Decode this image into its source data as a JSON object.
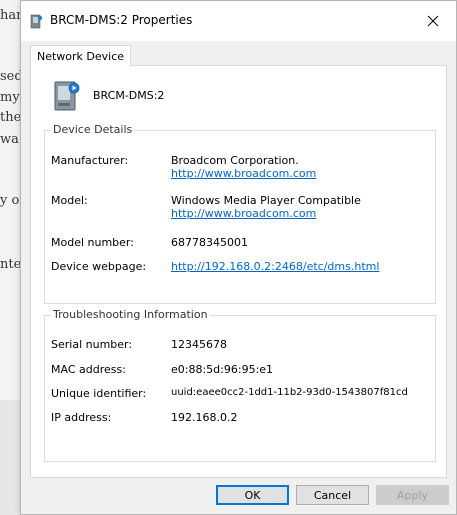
{
  "background_doc": {
    "fragments": [
      "har",
      "sed",
      "my",
      "the",
      "wa",
      "y of",
      "nte"
    ]
  },
  "window": {
    "title": "BRCM-DMS:2 Properties",
    "close_icon": "close-icon"
  },
  "tab": {
    "label": "Network Device"
  },
  "device": {
    "name": "BRCM-DMS:2",
    "icon": "media-device-icon"
  },
  "device_details": {
    "group_label": "Device Details",
    "manufacturer": {
      "label": "Manufacturer:",
      "value": "Broadcom Corporation.",
      "link": "http://www.broadcom.com"
    },
    "model": {
      "label": "Model:",
      "value": "Windows Media Player Compatible",
      "link": "http://www.broadcom.com"
    },
    "model_number": {
      "label": "Model number:",
      "value": "68778345001"
    },
    "webpage": {
      "label": "Device webpage:",
      "link": "http://192.168.0.2:2468/etc/dms.html"
    }
  },
  "troubleshooting": {
    "group_label": "Troubleshooting Information",
    "serial": {
      "label": "Serial number:",
      "value": "12345678"
    },
    "mac": {
      "label": "MAC address:",
      "value": "e0:88:5d:96:95:e1"
    },
    "uid": {
      "label": "Unique identifier:",
      "value": "uuid:eaee0cc2-1dd1-11b2-93d0-1543807f81cd"
    },
    "ip": {
      "label": "IP address:",
      "value": "192.168.0.2"
    }
  },
  "buttons": {
    "ok": "OK",
    "cancel": "Cancel",
    "apply": "Apply"
  },
  "colors": {
    "accent": "#0078d7",
    "link": "#0066cc",
    "dialog_bg": "#f0f0f0"
  }
}
